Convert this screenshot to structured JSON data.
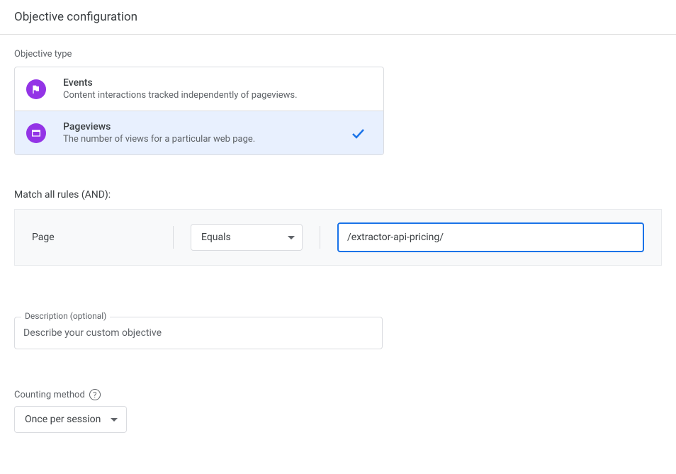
{
  "header": {
    "title": "Objective configuration"
  },
  "objective_type": {
    "label": "Objective type",
    "options": [
      {
        "id": "events",
        "title": "Events",
        "desc": "Content interactions tracked independently of pageviews.",
        "selected": false
      },
      {
        "id": "pageviews",
        "title": "Pageviews",
        "desc": "The number of views for a particular web page.",
        "selected": true
      }
    ]
  },
  "rules": {
    "label": "Match all rules (AND):",
    "field_label": "Page",
    "operator": "Equals",
    "value": "/extractor-api-pricing/"
  },
  "description": {
    "float_label": "Description (optional)",
    "placeholder": "Describe your custom objective",
    "value": ""
  },
  "counting": {
    "label": "Counting method",
    "value": "Once per session"
  }
}
